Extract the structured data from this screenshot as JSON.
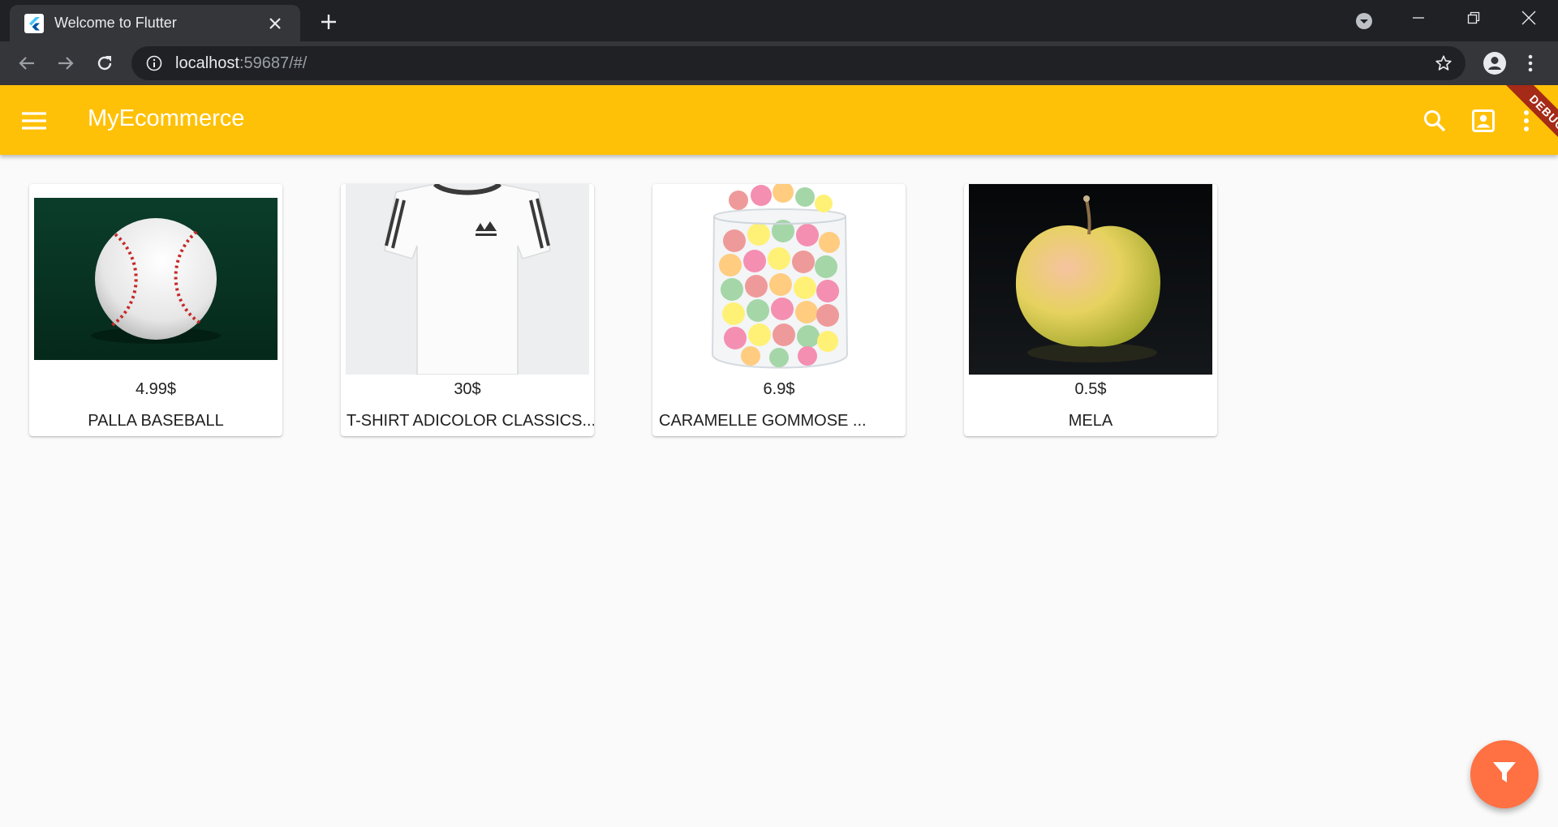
{
  "browser": {
    "tab_title": "Welcome to Flutter",
    "url_host": "localhost",
    "url_rest": ":59687/#/"
  },
  "appbar": {
    "title": "MyEcommerce",
    "debug_label": "DEBUG",
    "color": "#ffc107"
  },
  "products": [
    {
      "price": "4.99$",
      "name": "PALLA BASEBALL",
      "image": "baseball"
    },
    {
      "price": "30$",
      "name": "T-SHIRT ADICOLOR CLASSICS...",
      "image": "white-tshirt"
    },
    {
      "price": "6.9$",
      "name": "CARAMELLE GOMMOSE ...",
      "image": "gummy-candy-jar"
    },
    {
      "price": "0.5$",
      "name": "MELA",
      "image": "apple"
    }
  ],
  "fab": {
    "icon": "filter-icon",
    "color": "#ff7043"
  }
}
